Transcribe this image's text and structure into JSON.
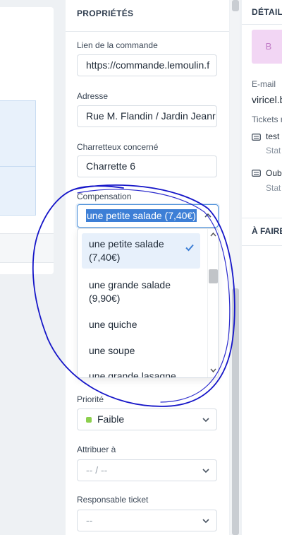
{
  "properties_panel": {
    "title": "PROPRIÉTÉS",
    "order_link": {
      "label": "Lien de la commande",
      "value": "https://commande.lemoulin.f"
    },
    "address": {
      "label": "Adresse",
      "value": "Rue M. Flandin / Jardin Jeanr"
    },
    "cart_driver": {
      "label": "Charretteux concerné",
      "value": "Charrette 6"
    },
    "compensation": {
      "label": "Compensation",
      "selected": "une petite salade (7,40€)",
      "options": [
        {
          "line1": "une petite salade",
          "line2": "(7,40€)"
        },
        {
          "line1": "une grande salade",
          "line2": "(9,90€)"
        },
        {
          "line1": "une quiche",
          "line2": ""
        },
        {
          "line1": "une soupe",
          "line2": ""
        },
        {
          "line1": "une grande lasagne",
          "line2": ""
        }
      ]
    },
    "priority": {
      "label": "Priorité",
      "value": "Faible",
      "color": "#8ccf4d"
    },
    "assign_to": {
      "label": "Attribuer à",
      "value": "-- / --"
    },
    "ticket_owner": {
      "label": "Responsable ticket",
      "value": "--"
    }
  },
  "details_panel": {
    "title": "DÉTAILS",
    "avatar_initial": "B",
    "email_label": "E-mail",
    "email_value": "viricel.b",
    "tickets_label": "Tickets r",
    "tickets": [
      {
        "title": "test",
        "status": "Stat"
      },
      {
        "title": "Oub",
        "status": "Stat"
      }
    ],
    "todo_title": "À FAIRE"
  },
  "colors": {
    "accent": "#3d7fd6",
    "annotation_ink": "#1515c8"
  },
  "icons": [
    "chevron-down-icon",
    "chevron-up-icon",
    "check-icon",
    "ticket-icon"
  ]
}
